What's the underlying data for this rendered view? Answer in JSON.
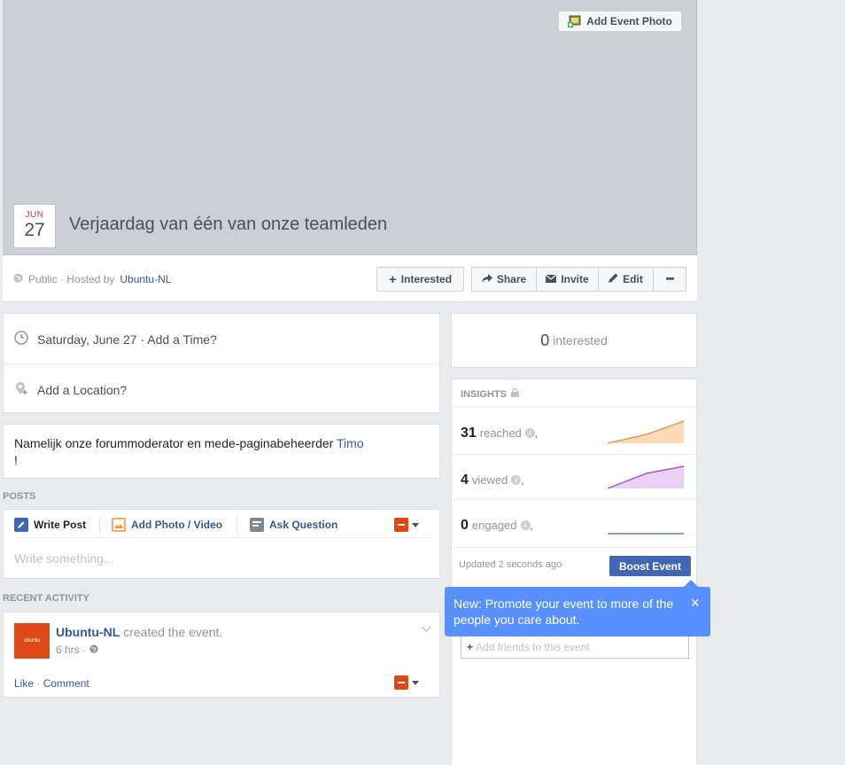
{
  "cover": {
    "add_photo_label": "Add Event Photo"
  },
  "event": {
    "month": "JUN",
    "day": "27",
    "title": "Verjaardag van één van onze teamleden",
    "privacy": "Public · Hosted by",
    "host": "Ubuntu-NL"
  },
  "actions": {
    "interested": "Interested",
    "share": "Share",
    "invite": "Invite",
    "edit": "Edit",
    "more": "•••"
  },
  "details": {
    "date": "Saturday, June 27 · Add a Time?",
    "location": "Add a Location?"
  },
  "description": {
    "text": "Namelijk onze forummoderator en mede-paginabeheerder ",
    "mention": "Timo",
    "trail": "!"
  },
  "posts": {
    "label": "POSTS",
    "write_post": "Write Post",
    "add_photo": "Add Photo / Video",
    "ask_question": "Ask Question",
    "placeholder": "Write something..."
  },
  "recent": {
    "label": "RECENT ACTIVITY",
    "actor": "Ubuntu-NL",
    "action": "created the event.",
    "time": "6 hrs ·",
    "like": "Like",
    "comment": "Comment",
    "sep": " · ",
    "avatar_text": "ubuntu"
  },
  "interested_card": {
    "count": "0",
    "label": "interested"
  },
  "insights": {
    "label": "INSIGHTS",
    "rows": [
      {
        "value": "31",
        "label": "reached",
        "color": "#f7a35c"
      },
      {
        "value": "4",
        "label": "viewed",
        "color": "#8e44ad"
      },
      {
        "value": "0",
        "label": "engaged",
        "color": "#4267b2"
      }
    ],
    "updated": "Updated 2 seconds ago",
    "boost": "Boost Event"
  },
  "tooltip": {
    "text": "New: Promote your event to more of the people you care about.",
    "close": "×"
  },
  "invite_field": {
    "placeholder": "Add friends to this event"
  },
  "colors": {
    "link": "#365899",
    "accent": "#4267b2",
    "tooltip": "#5890ff",
    "ubuntu": "#dd4814"
  }
}
